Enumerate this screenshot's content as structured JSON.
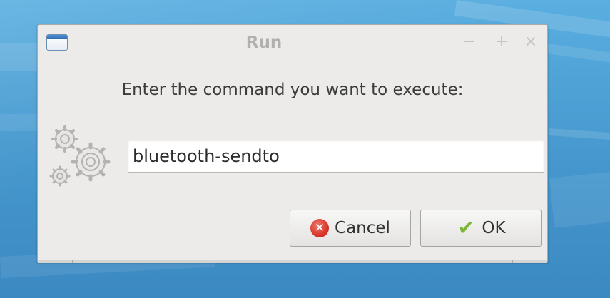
{
  "window": {
    "title": "Run",
    "controls": {
      "minimize": "−",
      "maximize": "+",
      "close": "×"
    }
  },
  "dialog": {
    "prompt": "Enter the command you want to execute:",
    "command_value": "bluetooth-sendto",
    "buttons": {
      "cancel_label": "Cancel",
      "ok_label": "OK"
    }
  },
  "icons": {
    "app": "window-icon",
    "gears": "gears-icon",
    "cancel": "cancel-icon",
    "ok": "checkmark-icon"
  },
  "colors": {
    "desktop_blue": "#4a9fd3",
    "window_bg": "#ecebea",
    "title_text": "#b1b0ad",
    "cancel_red": "#d8362b",
    "ok_green": "#7fb43a"
  }
}
